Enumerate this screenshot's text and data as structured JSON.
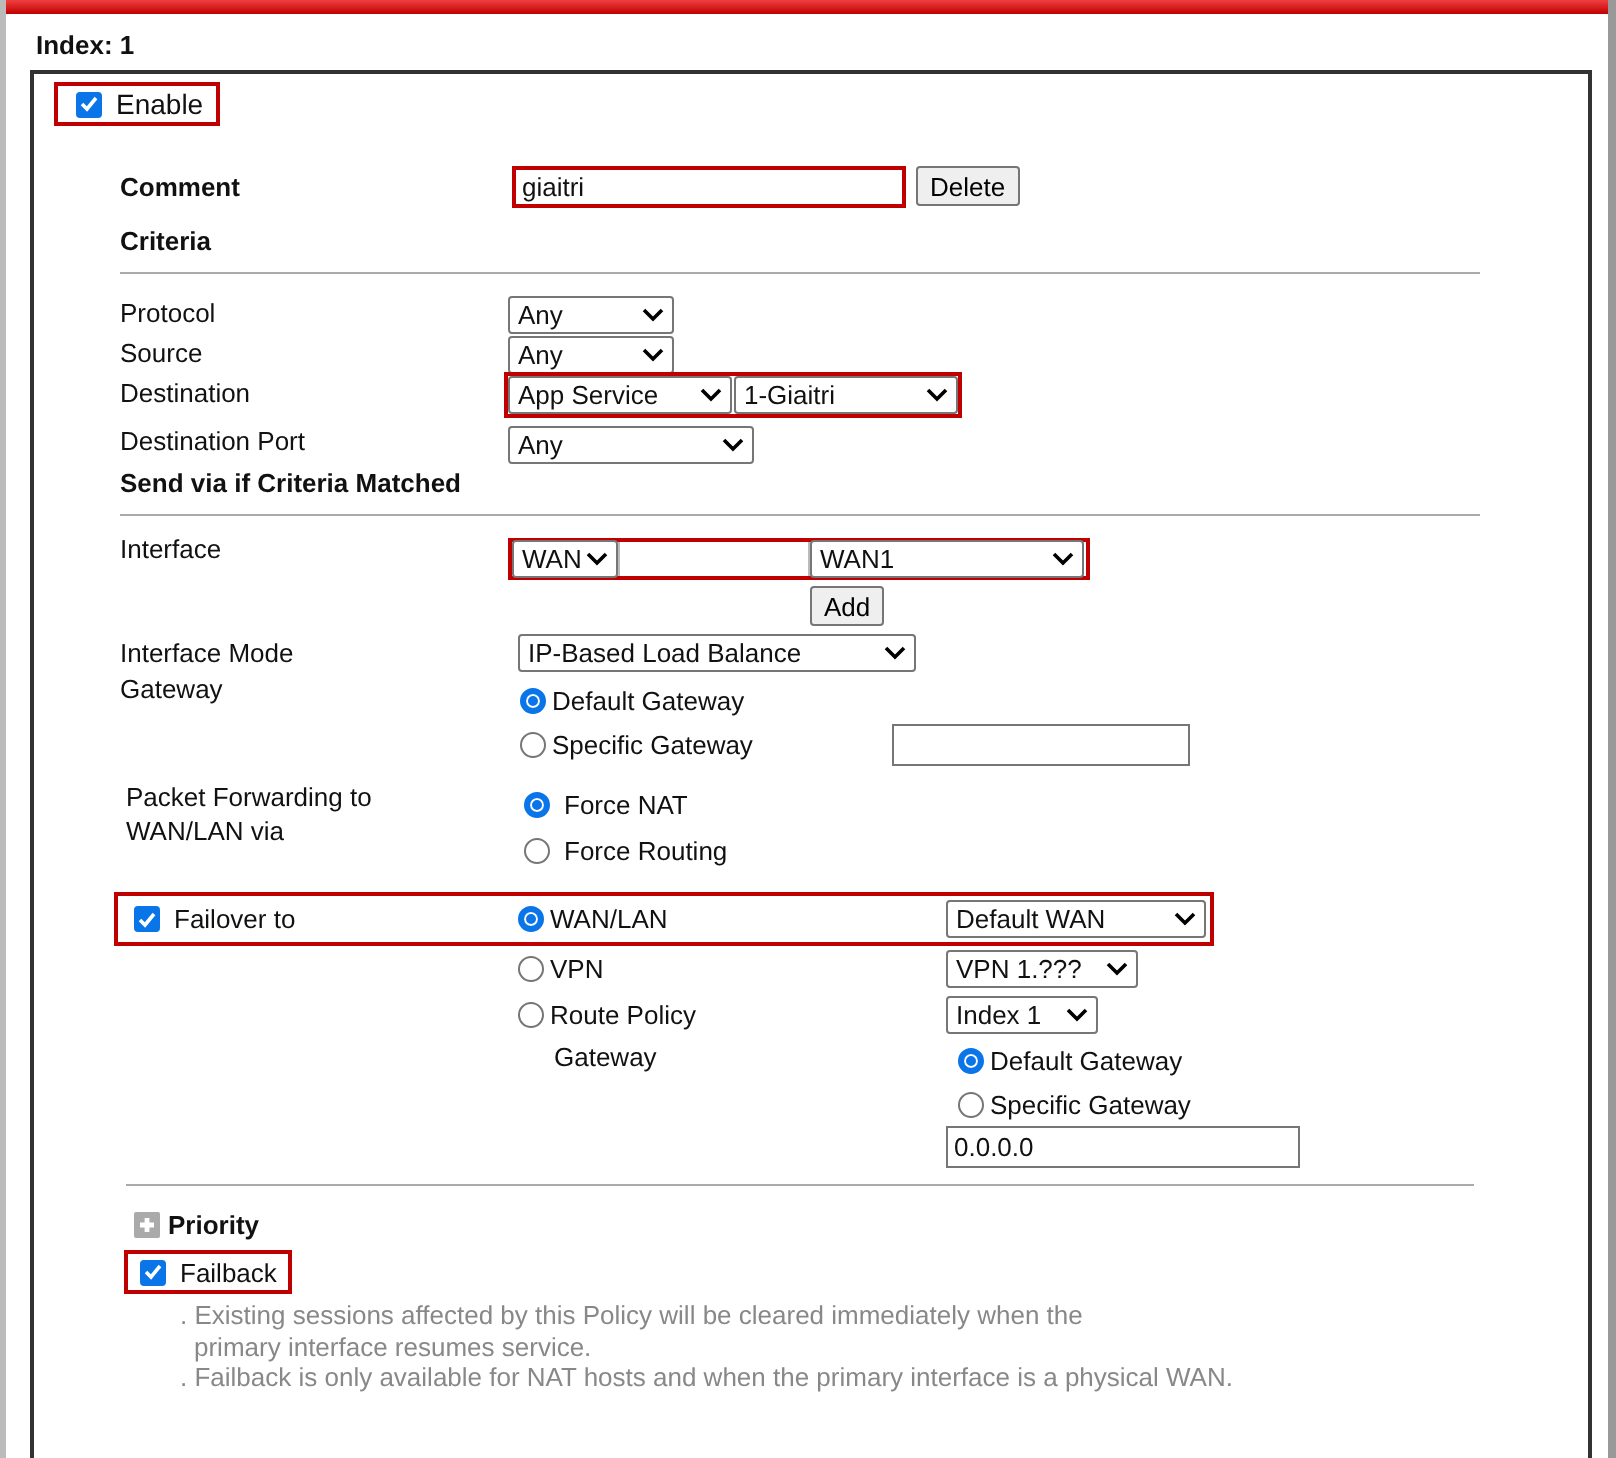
{
  "index_label": "Index: 1",
  "enable": {
    "label": "Enable",
    "checked": true,
    "highlighted": true
  },
  "comment": {
    "label": "Comment",
    "value": "giaitri",
    "highlighted": true,
    "button": "Delete"
  },
  "criteria": {
    "title": "Criteria",
    "rows": [
      {
        "label": "Protocol",
        "highlighted": false,
        "selects": [
          "Any"
        ]
      },
      {
        "label": "Source",
        "highlighted": false,
        "selects": [
          "Any"
        ]
      },
      {
        "label": "Destination",
        "highlighted": true,
        "selects": [
          "App Service",
          "1-Giaitri"
        ]
      },
      {
        "label": "Destination Port",
        "highlighted": false,
        "selects": [
          "Any"
        ]
      }
    ]
  },
  "send_via": {
    "title": "Send via if Criteria Matched",
    "interface": {
      "label": "Interface",
      "type": "WAN",
      "wan": "WAN1",
      "highlighted": true,
      "add_button": "Add"
    },
    "interface_mode": {
      "label": "Interface Mode",
      "value": "IP-Based Load Balance"
    },
    "gateway": {
      "label": "Gateway",
      "options": [
        {
          "label": "Default Gateway",
          "selected": true
        },
        {
          "label": "Specific Gateway",
          "selected": false
        }
      ]
    },
    "packet_forwarding": {
      "label": "Packet Forwarding to\nWAN/LAN via",
      "options": [
        {
          "label": "Force NAT",
          "selected": true
        },
        {
          "label": "Force Routing",
          "selected": false
        }
      ]
    }
  },
  "failover": {
    "label": "Failover to",
    "checked": true,
    "highlighted": true,
    "options": [
      {
        "label": "WAN/LAN",
        "selected": true,
        "select": "Default WAN"
      },
      {
        "label": "VPN",
        "selected": false,
        "select": "VPN 1.???"
      },
      {
        "label": "Route Policy",
        "selected": false,
        "select": "Index 1"
      }
    ],
    "gateway": {
      "label": "Gateway",
      "value": "0.0.0.0",
      "options": [
        {
          "label": "Default Gateway",
          "selected": true
        },
        {
          "label": "Specific Gateway",
          "selected": false
        }
      ]
    }
  },
  "priority": {
    "label": "Priority",
    "expanded": false
  },
  "failback": {
    "label": "Failback",
    "checked": true,
    "highlighted": true,
    "notes": [
      ". Existing sessions affected by this Policy will be cleared immediately when the\nprimary interface resumes service.",
      ". Failback is only available for NAT hosts and when the primary interface is a physical WAN."
    ]
  }
}
